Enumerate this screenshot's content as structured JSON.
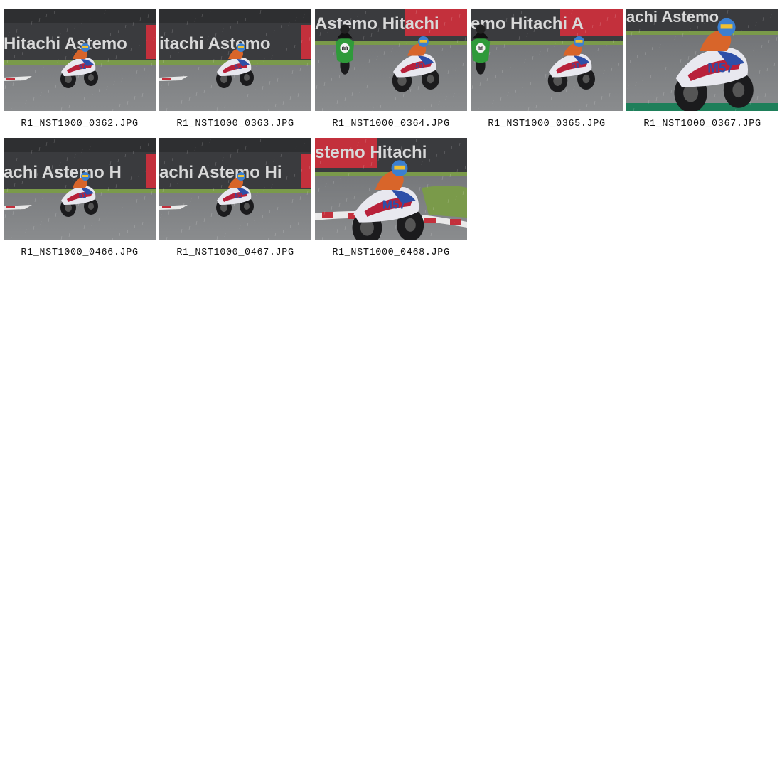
{
  "gallery": {
    "rows": [
      [
        {
          "filename": "R1_NST1000_0362.JPG",
          "scene": "wide-left",
          "banner": "Hitachi Astemo",
          "bike_number": "51"
        },
        {
          "filename": "R1_NST1000_0363.JPG",
          "scene": "wide-left",
          "banner": "itachi Astemo",
          "bike_number": "51"
        },
        {
          "filename": "R1_NST1000_0364.JPG",
          "scene": "duo",
          "banner": "Astemo Hitachi",
          "bike_number": "51",
          "rival_number": "88"
        },
        {
          "filename": "R1_NST1000_0365.JPG",
          "scene": "duo",
          "banner": "emo Hitachi A",
          "bike_number": "51",
          "rival_number": "88"
        },
        {
          "filename": "R1_NST1000_0367.JPG",
          "scene": "closeup",
          "banner": "achi Astemo",
          "bike_number": "M57"
        }
      ],
      [
        {
          "filename": "R1_NST1000_0466.JPG",
          "scene": "wide-left",
          "banner": "achi Astemo H",
          "bike_number": "51"
        },
        {
          "filename": "R1_NST1000_0467.JPG",
          "scene": "wide-left",
          "banner": "achi Astemo Hi",
          "bike_number": "51"
        },
        {
          "filename": "R1_NST1000_0468.JPG",
          "scene": "kerb",
          "banner": "stemo Hitachi",
          "bike_number": "M57"
        }
      ]
    ]
  },
  "colors": {
    "track": "#5f6163",
    "wall": "#3a3b3e",
    "banner_red": "#c3303c",
    "grass": "#7a9a4a",
    "fairing_white": "#e8e8ef",
    "fairing_blue": "#2d4fa8",
    "fairing_red": "#b8203a",
    "rider_orange": "#d8652a",
    "rival_green": "#2f9a3a"
  }
}
